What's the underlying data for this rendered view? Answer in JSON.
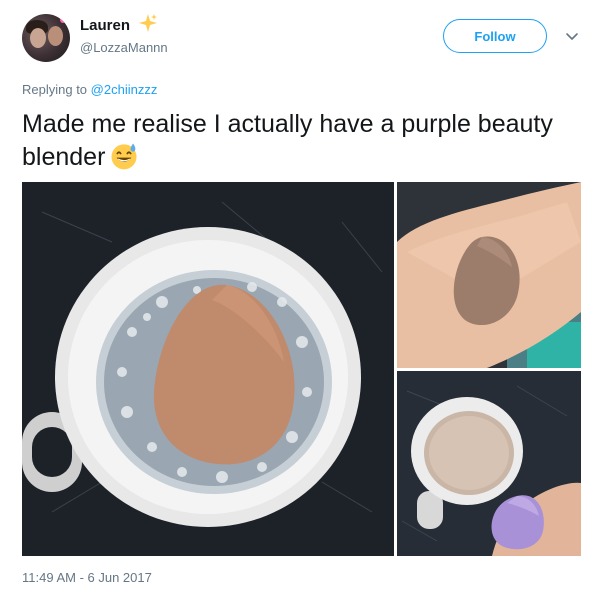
{
  "author": {
    "name": "Lauren",
    "handle": "@LozzaMannn"
  },
  "follow_label": "Follow",
  "reply": {
    "prefix": "Replying to",
    "mention": "@2chiinzzz"
  },
  "tweet_text": "Made me realise I actually have a purple beauty blender",
  "timestamp": "11:49 AM - 6 Jun 2017",
  "colors": {
    "accent": "#1da1f2",
    "muted": "#657786",
    "text": "#14171a"
  },
  "icons": [
    "sparkles-icon",
    "chevron-down-icon",
    "grinning-sweat-emoji"
  ]
}
